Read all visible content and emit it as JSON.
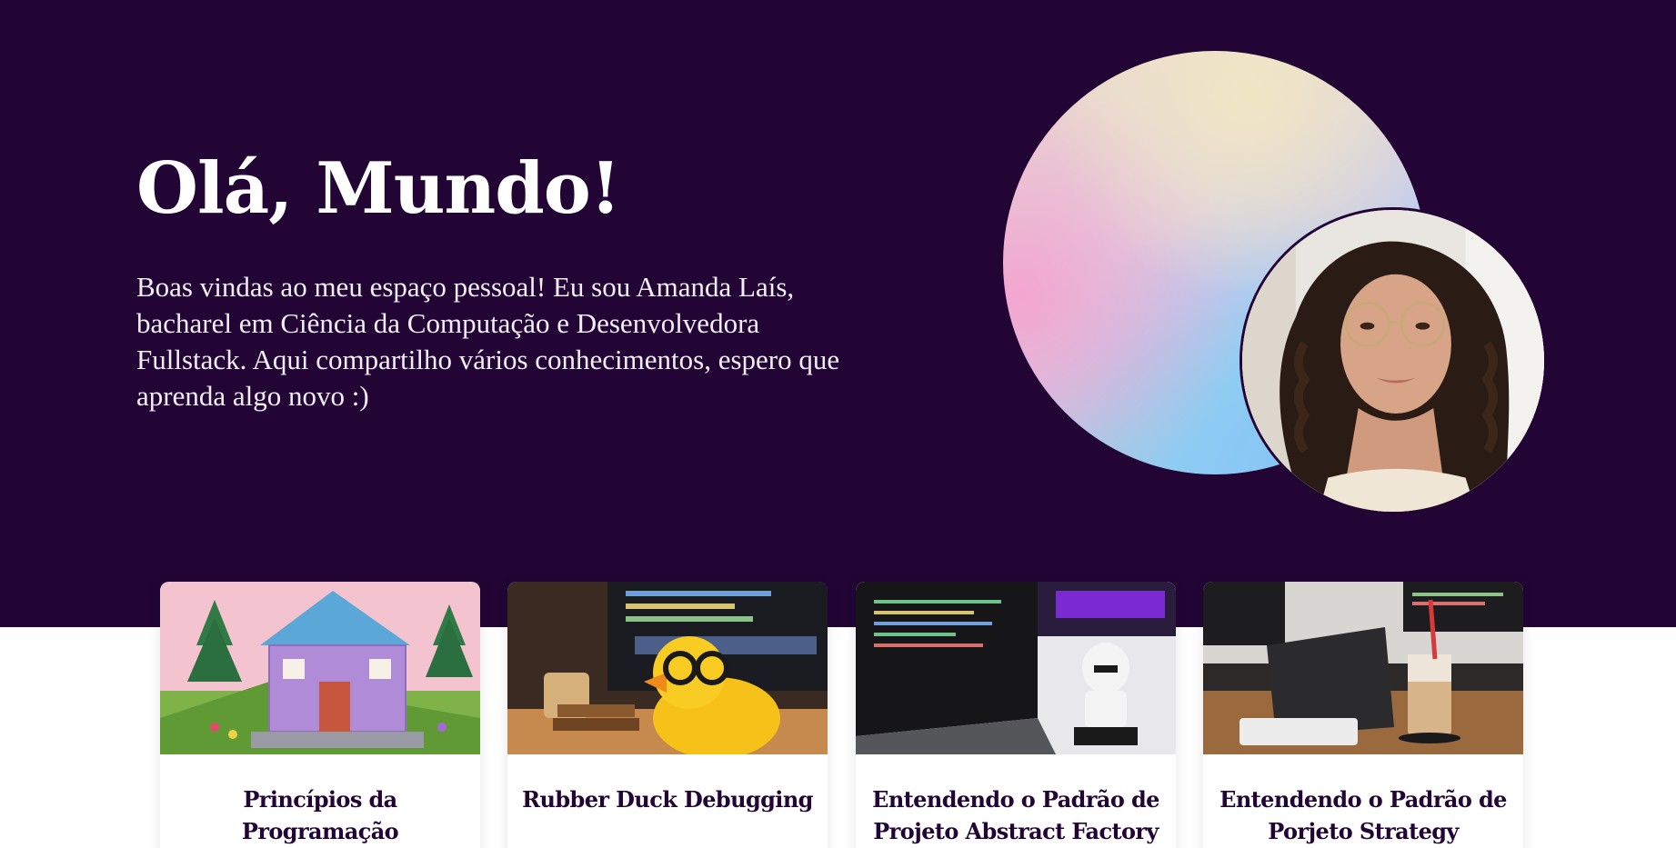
{
  "hero": {
    "title": "Olá, Mundo!",
    "intro": "Boas vindas ao meu espaço pessoal! Eu sou Amanda Laís, bacharel em Ciência da Computação e Desenvolvedora Fullstack. Aqui compartilho vários conhecimentos, espero que aprenda algo novo :)"
  },
  "colors": {
    "background": "#220535",
    "text": "#ffffff",
    "card_title": "#220535"
  },
  "posts": [
    {
      "title": "Princípios da Programação",
      "image": "lego-house-image"
    },
    {
      "title": "Rubber Duck Debugging",
      "image": "rubber-duck-image"
    },
    {
      "title": "Entendendo o Padrão de Projeto Abstract Factory",
      "image": "laptop-stormtrooper-image"
    },
    {
      "title": "Entendendo o Padrão de Porjeto Strategy",
      "image": "tablet-coffee-image"
    }
  ]
}
